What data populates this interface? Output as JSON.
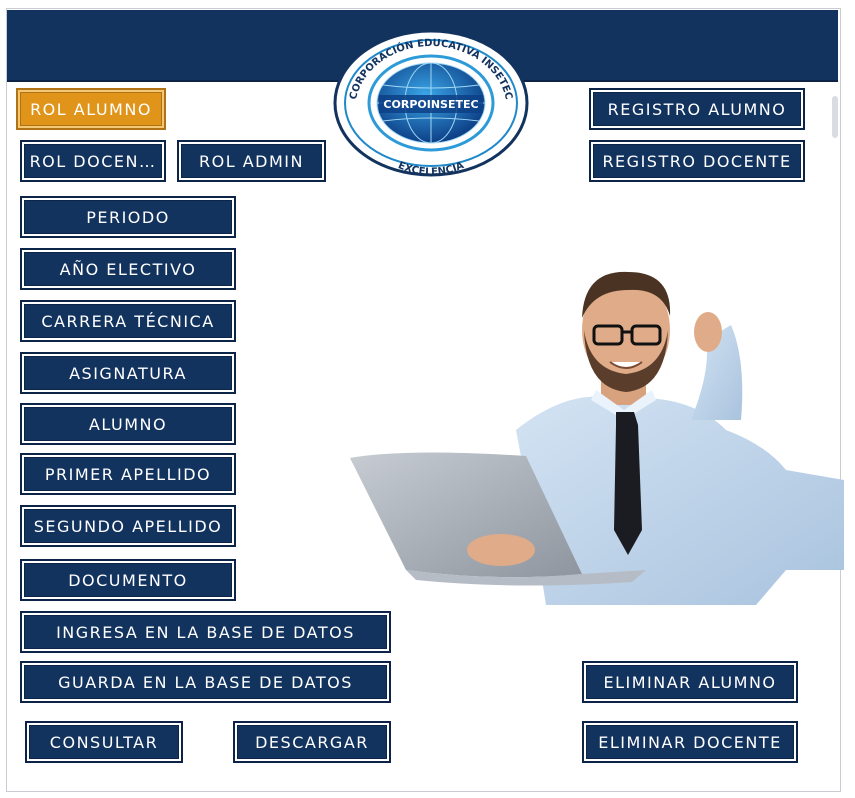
{
  "colors": {
    "navy": "#13335f",
    "active": "#e0941a",
    "background": "#ffffff"
  },
  "logo": {
    "ring_text": "CORPORACIÓN EDUCATIVA INSETEC",
    "center_text": "CORPOINSETEC",
    "bottom_text": "EXCELENCIA",
    "icon": "globe-icon"
  },
  "roles": {
    "alumno": "ROL ALUMNO",
    "docente": "ROL DOCEN…",
    "admin": "ROL ADMIN"
  },
  "registros": {
    "alumno": "REGISTRO ALUMNO",
    "docente": "REGISTRO DOCENTE"
  },
  "fields": [
    "PERIODO",
    "AÑO ELECTIVO",
    "CARRERA TÉCNICA",
    "ASIGNATURA",
    "ALUMNO",
    "PRIMER APELLIDO",
    "SEGUNDO APELLIDO",
    "DOCUMENTO"
  ],
  "database": {
    "ingresa": "INGRESA EN LA BASE DE DATOS",
    "guarda": "GUARDA EN LA BASE DE DATOS"
  },
  "actions": {
    "consultar": "CONSULTAR",
    "descargar": "DESCARGAR",
    "eliminar_alumno": "ELIMINAR ALUMNO",
    "eliminar_docente": "ELIMINAR DOCENTE"
  },
  "illustration": "man-with-laptop-image"
}
